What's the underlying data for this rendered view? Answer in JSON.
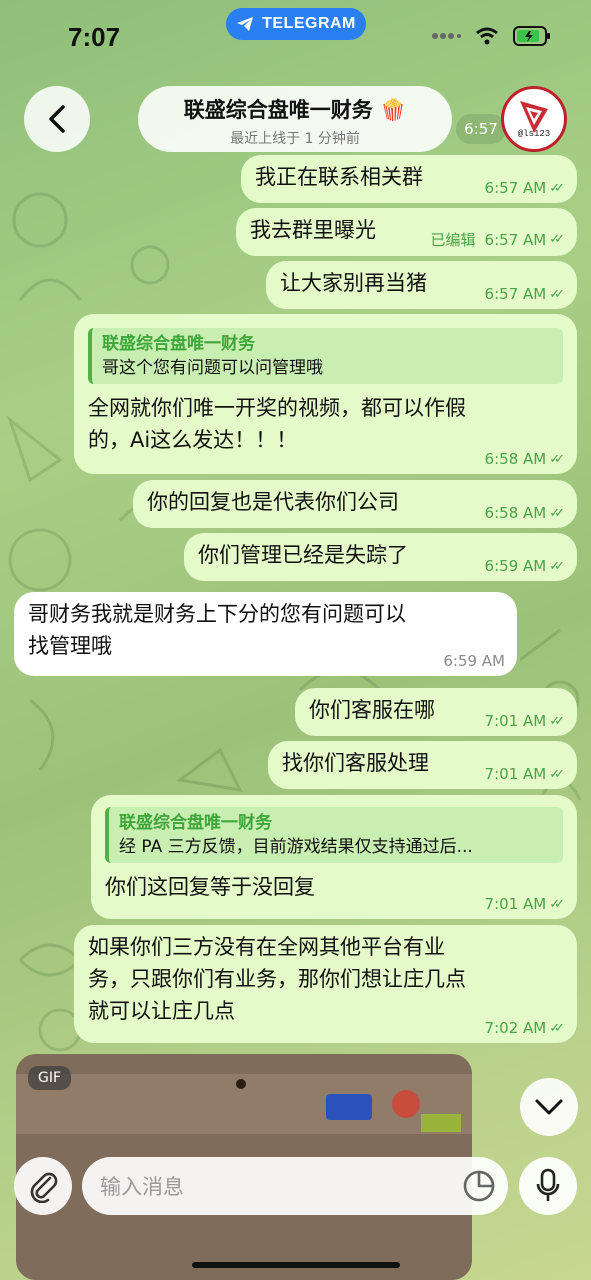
{
  "status": {
    "time": "7:07",
    "app_pill": "TELEGRAM"
  },
  "header": {
    "title": "联盛综合盘唯一财务 🍿",
    "subtitle": "最近上线于 1 分钟前",
    "avatar_handle": "@ls123",
    "peek_time": "6:57"
  },
  "messages": [
    {
      "text": "我正在联系相关群",
      "time": "6:57 AM"
    },
    {
      "text": "我去群里曝光",
      "edited": "已编辑",
      "time": "6:57 AM"
    },
    {
      "text": "让大家别再当猪",
      "time": "6:57 AM"
    },
    {
      "reply_name": "联盛综合盘唯一财务",
      "reply_text": "哥这个您有问题可以问管理哦",
      "line1": "全网就你们唯一开奖的视频，都可以作假",
      "line2": "的，Ai这么发达！！！",
      "time": "6:58 AM"
    },
    {
      "text": "你的回复也是代表你们公司",
      "time": "6:58 AM"
    },
    {
      "text": "你们管理已经是失踪了",
      "time": "6:59 AM"
    },
    {
      "line1": "哥财务我就是财务上下分的您有问题可以",
      "line2": "找管理哦",
      "time": "6:59 AM"
    },
    {
      "text": "你们客服在哪",
      "time": "7:01 AM"
    },
    {
      "text": "找你们客服处理",
      "time": "7:01 AM"
    },
    {
      "reply_name": "联盛综合盘唯一财务",
      "reply_text": "经 PA 三方反馈，目前游戏结果仅支持通过后...",
      "text": "你们这回复等于没回复",
      "time": "7:01 AM"
    },
    {
      "line1": "如果你们三方没有在全网其他平台有业",
      "line2": "务，只跟你们有业务，那你们想让庄几点",
      "line3": "就可以让庄几点",
      "time": "7:02 AM"
    }
  ],
  "media": {
    "badge": "GIF"
  },
  "input": {
    "placeholder": "输入消息"
  },
  "colors": {
    "accent": "#2a7ff2",
    "out_bubble": "#e4fbc9",
    "in_bubble": "#ffffff",
    "read_check": "#4aa34a"
  }
}
